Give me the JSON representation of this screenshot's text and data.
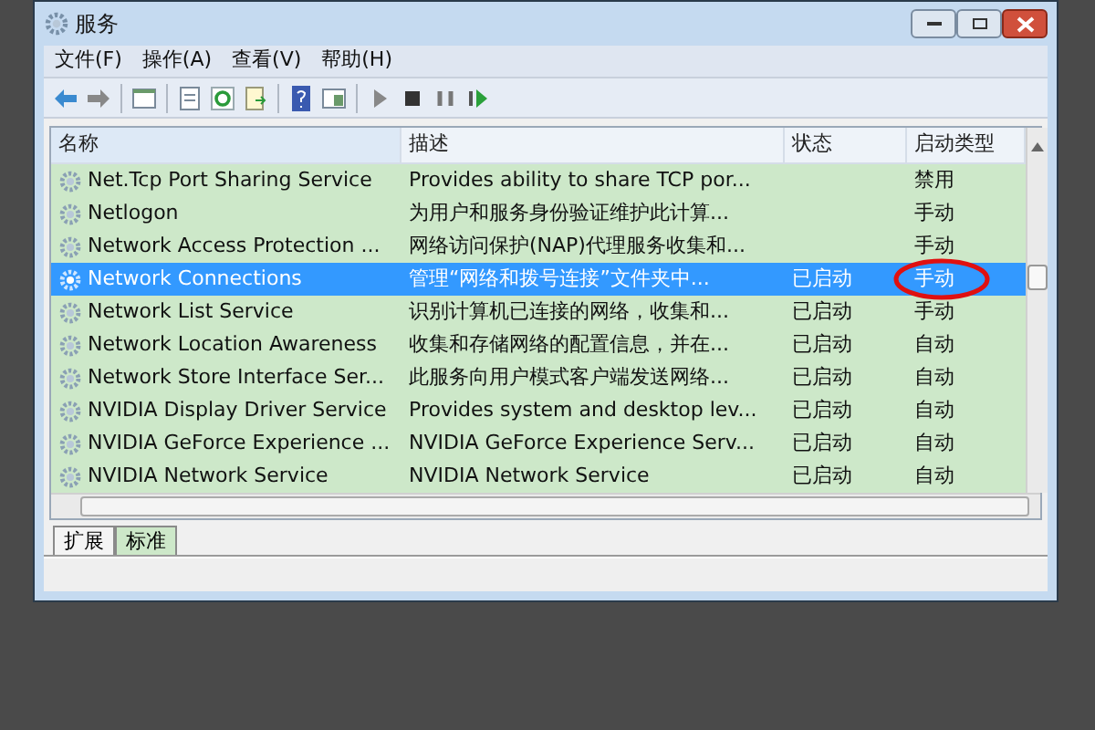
{
  "window": {
    "title": "服务"
  },
  "menu": [
    "文件(F)",
    "操作(A)",
    "查看(V)",
    "帮助(H)"
  ],
  "table": {
    "columns": [
      "名称",
      "描述",
      "状态",
      "启动类型"
    ],
    "rows": [
      {
        "name": "Net.Tcp Port Sharing Service",
        "description": "Provides ability to share TCP por...",
        "status": "",
        "startup": "禁用",
        "selected": false
      },
      {
        "name": "Netlogon",
        "description": "为用户和服务身份验证维护此计算...",
        "status": "",
        "startup": "手动",
        "selected": false
      },
      {
        "name": "Network Access Protection ...",
        "description": "网络访问保护(NAP)代理服务收集和...",
        "status": "",
        "startup": "手动",
        "selected": false
      },
      {
        "name": "Network Connections",
        "description": "管理“网络和拨号连接”文件夹中...",
        "status": "已启动",
        "startup": "手动",
        "selected": true,
        "circled": true
      },
      {
        "name": "Network List Service",
        "description": "识别计算机已连接的网络，收集和...",
        "status": "已启动",
        "startup": "手动",
        "selected": false
      },
      {
        "name": "Network Location Awareness",
        "description": "收集和存储网络的配置信息，并在...",
        "status": "已启动",
        "startup": "自动",
        "selected": false
      },
      {
        "name": "Network Store Interface Ser...",
        "description": "此服务向用户模式客户端发送网络...",
        "status": "已启动",
        "startup": "自动",
        "selected": false
      },
      {
        "name": "NVIDIA Display Driver Service",
        "description": "Provides system and desktop lev...",
        "status": "已启动",
        "startup": "自动",
        "selected": false
      },
      {
        "name": "NVIDIA GeForce Experience ...",
        "description": "NVIDIA GeForce Experience Serv...",
        "status": "已启动",
        "startup": "自动",
        "selected": false
      },
      {
        "name": "NVIDIA Network Service",
        "description": "NVIDIA Network Service",
        "status": "已启动",
        "startup": "自动",
        "selected": false
      }
    ]
  },
  "tabs": [
    {
      "label": "扩展",
      "selected": false
    },
    {
      "label": "标准",
      "selected": true
    }
  ]
}
